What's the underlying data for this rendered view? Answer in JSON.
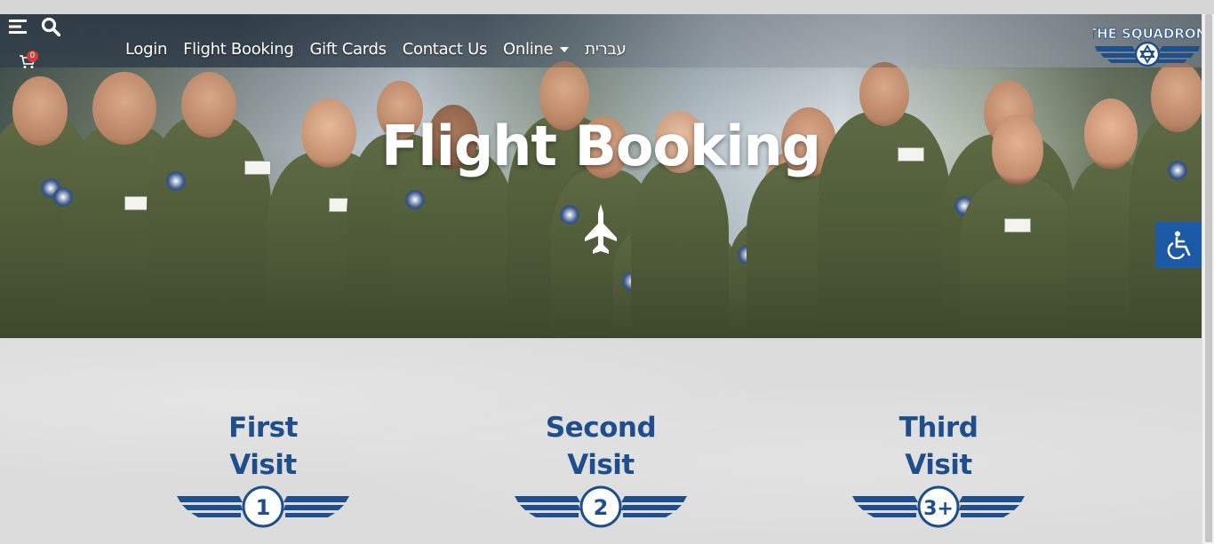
{
  "nav": {
    "links": [
      "Login",
      "Flight Booking",
      "Gift Cards",
      "Contact Us",
      "Online",
      "עברית"
    ],
    "cart_count": "0"
  },
  "logo": {
    "text": "THE SQUADRON"
  },
  "hero": {
    "title": "Flight Booking"
  },
  "visits": [
    {
      "line1": "First",
      "line2": "Visit",
      "badge": "1"
    },
    {
      "line1": "Second",
      "line2": "Visit",
      "badge": "2"
    },
    {
      "line1": "Third",
      "line2": "Visit",
      "badge": "3+"
    }
  ],
  "colors": {
    "brand_blue": "#1f4e8c",
    "accessibility_blue": "#1d5aa6",
    "cart_badge": "#d63a3a"
  },
  "icons": [
    "menu-icon",
    "search-icon",
    "cart-icon",
    "chevron-down-icon",
    "fighter-jet-icon",
    "wheelchair-icon",
    "pilot-wings-icon"
  ]
}
